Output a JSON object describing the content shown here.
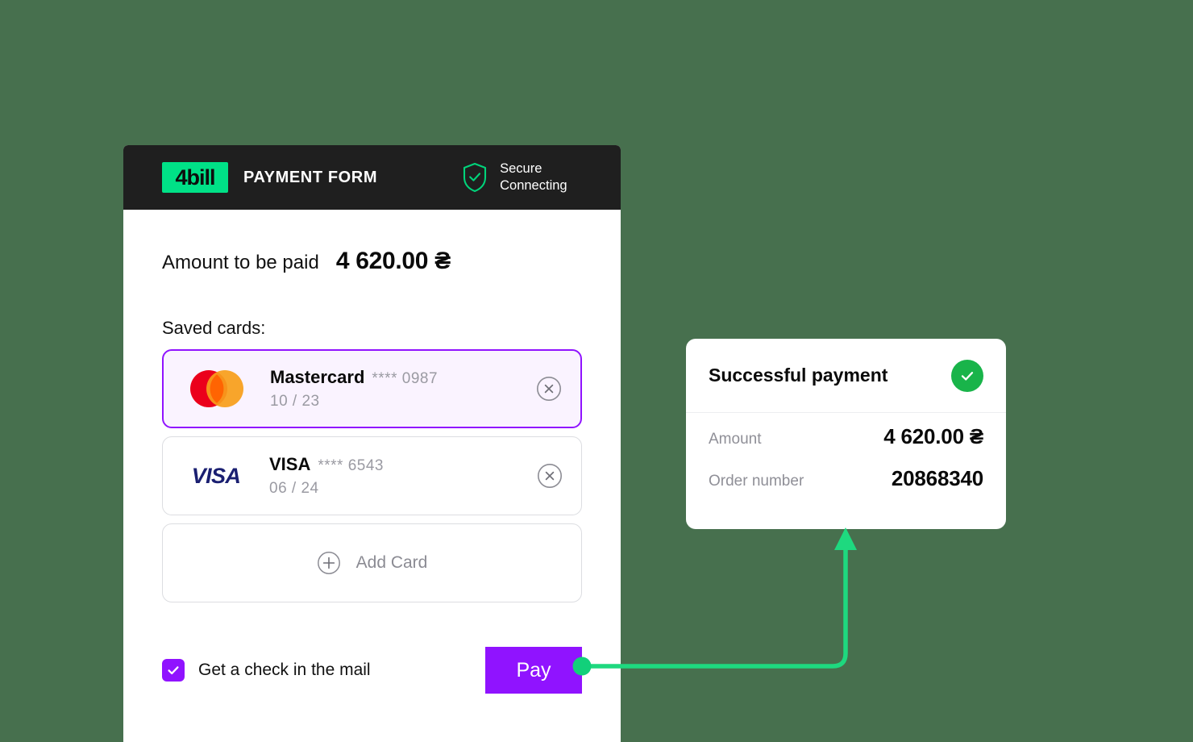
{
  "theme": {
    "page_background": "#47704E",
    "accent_purple": "#9013FF",
    "brand_green": "#00E187",
    "success_green": "#19B44A",
    "connector_green": "#1ED97F",
    "header_dark": "#1F1F1F"
  },
  "payment_form": {
    "header": {
      "logo_text": "4bill",
      "title": "PAYMENT FORM",
      "shield_icon": "shield-check-icon",
      "secure_line1": "Secure",
      "secure_line2": "Connecting"
    },
    "amount": {
      "label": "Amount to be paid",
      "value": "4 620.00 ₴"
    },
    "saved_cards_label": "Saved cards:",
    "cards": [
      {
        "brand": "Mastercard",
        "brand_logo": "mastercard-logo",
        "mask": "**** 0987",
        "expiry": "10 / 23",
        "selected": true,
        "remove_icon": "remove-circle-icon"
      },
      {
        "brand": "VISA",
        "brand_logo": "visa-logo",
        "mask": "**** 6543",
        "expiry": "06 / 24",
        "selected": false,
        "remove_icon": "remove-circle-icon"
      }
    ],
    "add_card": {
      "label": "Add Card",
      "icon": "plus-circle-icon"
    },
    "footer": {
      "checkbox_label": "Get a check in the mail",
      "checkbox_checked": true,
      "checkbox_icon": "checkmark-icon",
      "pay_label": "Pay"
    }
  },
  "success_panel": {
    "title": "Successful payment",
    "status_icon": "check-circle-icon",
    "rows": [
      {
        "label": "Amount",
        "value": "4 620.00 ₴"
      },
      {
        "label": "Order number",
        "value": "20868340"
      }
    ]
  },
  "connector": {
    "start_icon": "connector-dot",
    "end_icon": "arrow-up-icon"
  }
}
